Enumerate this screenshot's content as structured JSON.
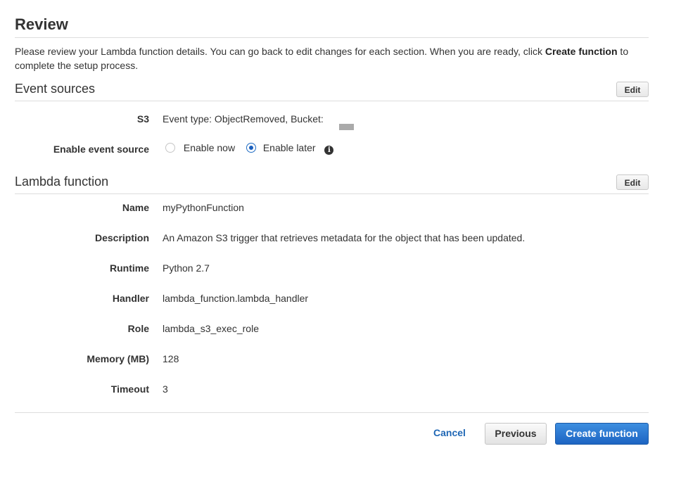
{
  "page": {
    "title": "Review",
    "intro_prefix": "Please review your Lambda function details. You can go back to edit changes for each section. When you are ready, click ",
    "intro_bold": "Create function",
    "intro_suffix": " to complete the setup process."
  },
  "event_sources": {
    "title": "Event sources",
    "edit_label": "Edit",
    "s3_label": "S3",
    "s3_value": "Event type: ObjectRemoved, Bucket:",
    "enable_label": "Enable event source",
    "options": [
      {
        "label": "Enable now",
        "selected": false
      },
      {
        "label": "Enable later",
        "selected": true
      }
    ],
    "info_icon": "info-circle-icon"
  },
  "lambda_function": {
    "title": "Lambda function",
    "edit_label": "Edit",
    "fields": [
      {
        "label": "Name",
        "value": "myPythonFunction"
      },
      {
        "label": "Description",
        "value": "An Amazon S3 trigger that retrieves metadata for the object that has been updated."
      },
      {
        "label": "Runtime",
        "value": "Python 2.7"
      },
      {
        "label": "Handler",
        "value": "lambda_function.lambda_handler"
      },
      {
        "label": "Role",
        "value": "lambda_s3_exec_role"
      },
      {
        "label": "Memory (MB)",
        "value": "128"
      },
      {
        "label": "Timeout",
        "value": "3"
      }
    ]
  },
  "footer": {
    "cancel_label": "Cancel",
    "previous_label": "Previous",
    "create_label": "Create function"
  },
  "colors": {
    "primary_button": "#1d64c2",
    "link": "#1f67b5",
    "divider": "#dddddd"
  }
}
